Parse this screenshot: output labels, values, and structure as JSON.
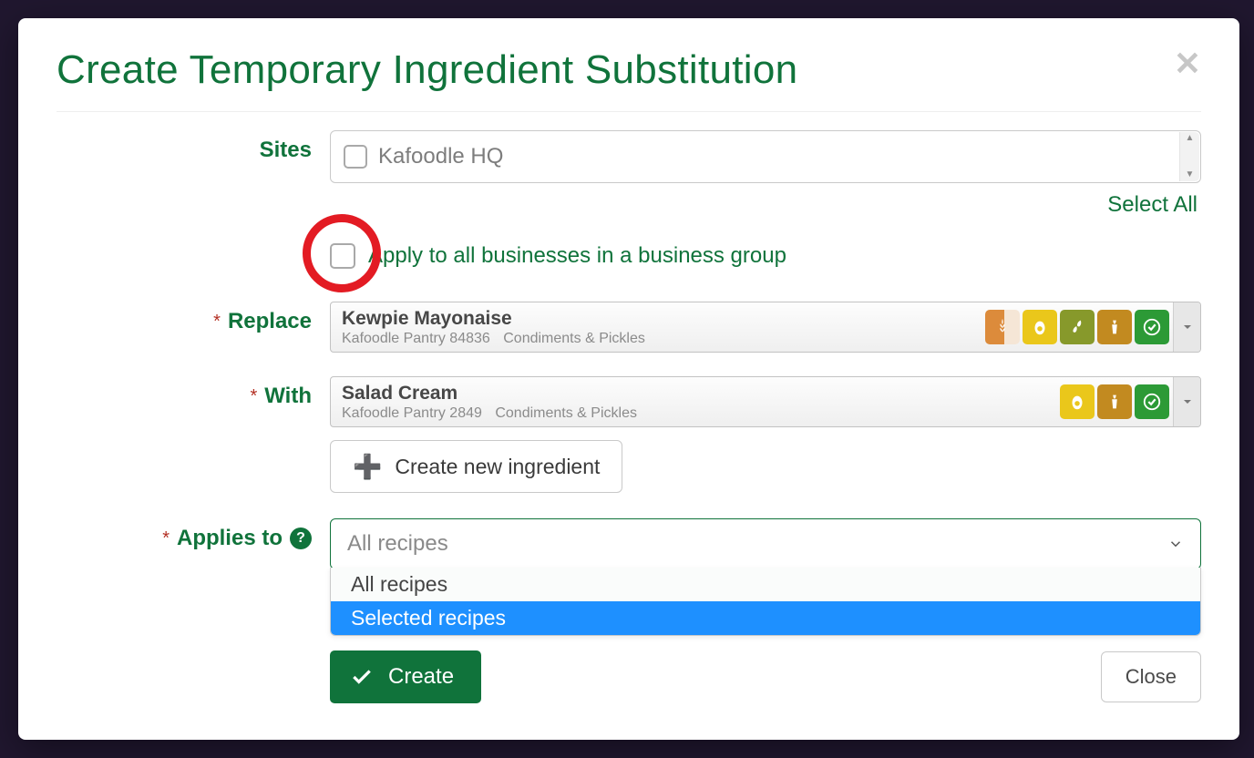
{
  "modal": {
    "title": "Create Temporary Ingredient Substitution",
    "close_label": "Close"
  },
  "labels": {
    "sites": "Sites",
    "replace": "Replace",
    "with": "With",
    "applies_to": "Applies to",
    "select_all": "Select All",
    "apply_all": "Apply to all businesses in a business group",
    "create_ingredient": "Create new ingredient",
    "create": "Create"
  },
  "sites": {
    "options": [
      {
        "name": "Kafoodle HQ",
        "checked": false
      }
    ]
  },
  "apply_all_checked": false,
  "replace": {
    "name": "Kewpie Mayonaise",
    "source": "Kafoodle Pantry 84836",
    "category": "Condiments & Pickles",
    "badges": [
      "wheat",
      "egg",
      "soy",
      "mustard",
      "verified"
    ]
  },
  "with": {
    "name": "Salad Cream",
    "source": "Kafoodle Pantry 2849",
    "category": "Condiments & Pickles",
    "badges": [
      "egg",
      "mustard",
      "verified"
    ]
  },
  "applies_to": {
    "placeholder": "All recipes",
    "options": [
      "All recipes",
      "Selected recipes"
    ],
    "highlighted": "Selected recipes",
    "open": true
  },
  "colors": {
    "primary": "#10733b",
    "highlight_ring": "#e31b23",
    "dropdown_selected": "#1e90ff"
  }
}
